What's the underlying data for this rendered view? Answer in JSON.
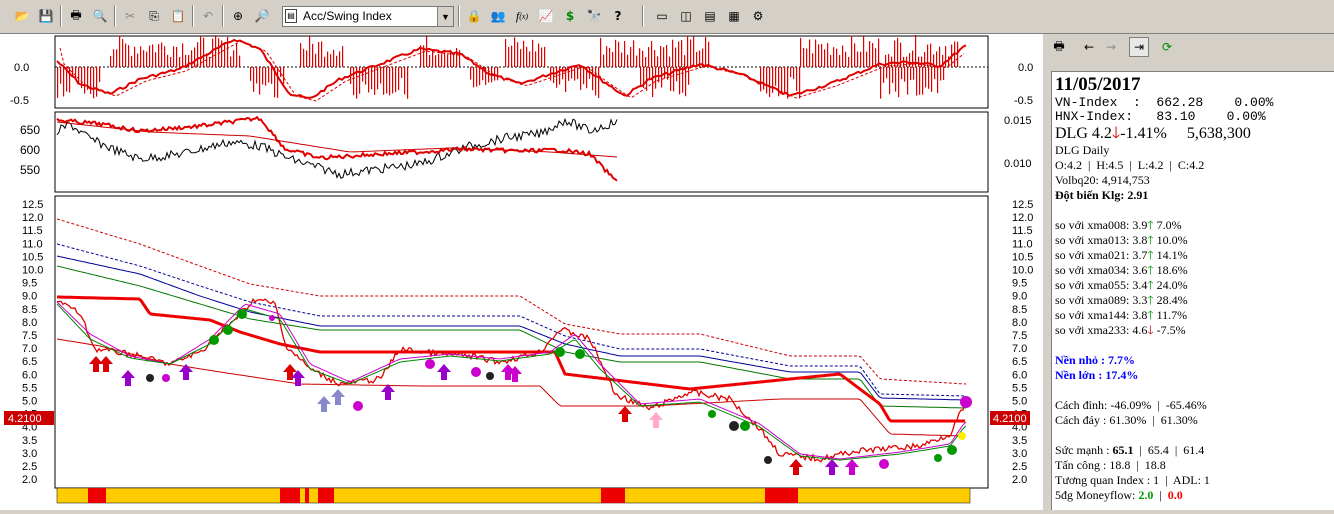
{
  "toolbar": {
    "indicator_select": "Acc/Swing Index",
    "icons": [
      "open-icon",
      "save-icon",
      "print-icon",
      "print-preview-icon",
      "cut-icon",
      "copy-icon",
      "paste-icon",
      "undo-icon",
      "crosshair-icon",
      "zoom-icon",
      "lock-icon",
      "portfolio-icon",
      "formula-icon",
      "chart-up-icon",
      "dollar-icon",
      "binoculars-icon",
      "help-icon",
      "window-icon",
      "layout-1-icon",
      "layout-2-icon",
      "layout-4-icon",
      "settings-icon"
    ]
  },
  "chart": {
    "top_ticks_left": [
      "0.0",
      "-0.5"
    ],
    "top_ticks_right": [
      "0.0",
      "-0.5"
    ],
    "mid_ticks_left": [
      "650",
      "600",
      "550"
    ],
    "mid_ticks_right": [
      "0.015",
      "0.010"
    ],
    "main_ticks": [
      "12.5",
      "12.0",
      "11.5",
      "11.0",
      "10.5",
      "10.0",
      "9.5",
      "9.0",
      "8.5",
      "8.0",
      "7.5",
      "7.0",
      "6.5",
      "6.0",
      "5.5",
      "5.0",
      "4.5",
      "4.0",
      "3.5",
      "3.0",
      "2.5",
      "2.0"
    ],
    "price_tag_left": "4.2100",
    "price_tag_right": "4.2100",
    "colors": {
      "price_red": "#e00000",
      "sma_thick": "#ee0000",
      "band_green": "#007700",
      "band_blue": "#000099",
      "yellow_bar": "#ffcc00"
    }
  },
  "right_tools": [
    "print-icon",
    "back-icon",
    "forward-icon",
    "goto-end-icon",
    "refresh-icon"
  ],
  "info": {
    "date": "11/05/2017",
    "vn_index": "VN-Index  :  662.28    0.00%",
    "hnx_index": "HNX-Index:   83.10    0.00%",
    "ticker": "DLG 4.2",
    "ticker_change": "-1.41%",
    "ticker_volume": "5,638,300",
    "daily": "DLG Daily",
    "ohlc": "O:4.2  |  H:4.5  |  L:4.2  |  C:4.2",
    "volbq": "Volbq20: 4,914,753",
    "dot_bien": "Đột biến Klg: 2.91",
    "xma": [
      {
        "label": "so với xma008:",
        "value": "3.9",
        "dir": "up",
        "pct": "7.0%"
      },
      {
        "label": "so với xma013:",
        "value": "3.8",
        "dir": "up",
        "pct": "10.0%"
      },
      {
        "label": "so với xma021:",
        "value": "3.7",
        "dir": "up",
        "pct": "14.1%"
      },
      {
        "label": "so với xma034:",
        "value": "3.6",
        "dir": "up",
        "pct": "18.6%"
      },
      {
        "label": "so với xma055:",
        "value": "3.4",
        "dir": "up",
        "pct": "24.0%"
      },
      {
        "label": "so với xma089:",
        "value": "3.3",
        "dir": "up",
        "pct": "28.4%"
      },
      {
        "label": "so với xma144:",
        "value": "3.8",
        "dir": "up",
        "pct": "11.7%"
      },
      {
        "label": "so với xma233:",
        "value": "4.6",
        "dir": "down",
        "pct": "-7.5%"
      }
    ],
    "nen_nho": "Nền nhỏ : 7.7%",
    "nen_lon": "Nền lớn : 17.4%",
    "cach_dinh": "Cách đỉnh: -46.09%  |  -65.46%",
    "cach_day": "Cách đáy : 61.30%  |  61.30%",
    "suc_manh_label": "Sức mạnh : ",
    "suc_manh_bold": "65.1",
    "suc_manh_rest": "  |  65.4  |  61.4",
    "tan_cong": "Tấn công : 18.8  |  18.8",
    "tuong_quan": "Tương quan Index : 1  |  ADL: 1",
    "moneyflow_label": "5đg Moneyflow: ",
    "moneyflow_pos": "2.0",
    "moneyflow_sep": "  |  ",
    "moneyflow_neg": "0.0"
  }
}
